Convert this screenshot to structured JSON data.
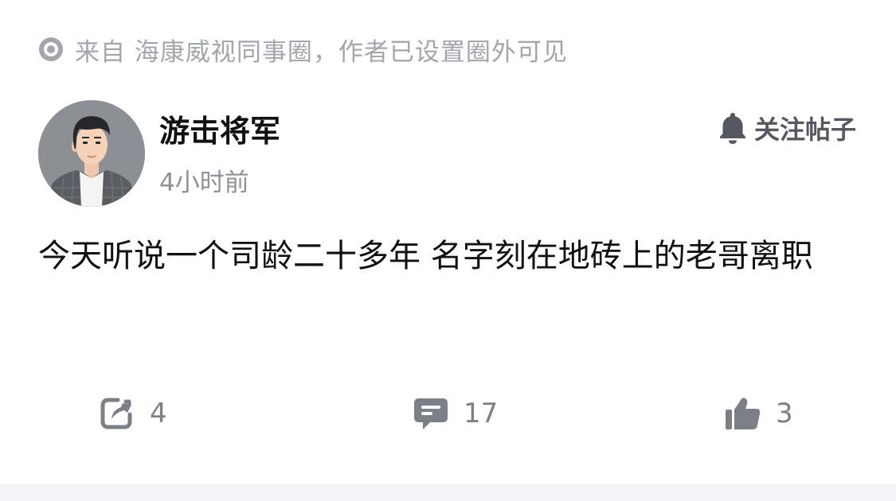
{
  "source": {
    "icon": "radio-icon",
    "text": "来自 海康威视同事圈，作者已设置圈外可见"
  },
  "author": {
    "name": "游击将军",
    "time": "4小时前",
    "avatar": "avatar-illustration"
  },
  "follow": {
    "icon": "bell-icon",
    "label": "关注帖子"
  },
  "post": {
    "content": "今天听说一个司龄二十多年 名字刻在地砖上的老哥离职"
  },
  "actions": {
    "share": {
      "icon": "share-icon",
      "count": "4"
    },
    "comment": {
      "icon": "comment-icon",
      "count": "17"
    },
    "like": {
      "icon": "thumbs-up-icon",
      "count": "3"
    }
  },
  "colors": {
    "muted": "#a3a6ad",
    "icon": "#7c7f86",
    "text": "#111111",
    "footer": "#f3f4f7"
  }
}
